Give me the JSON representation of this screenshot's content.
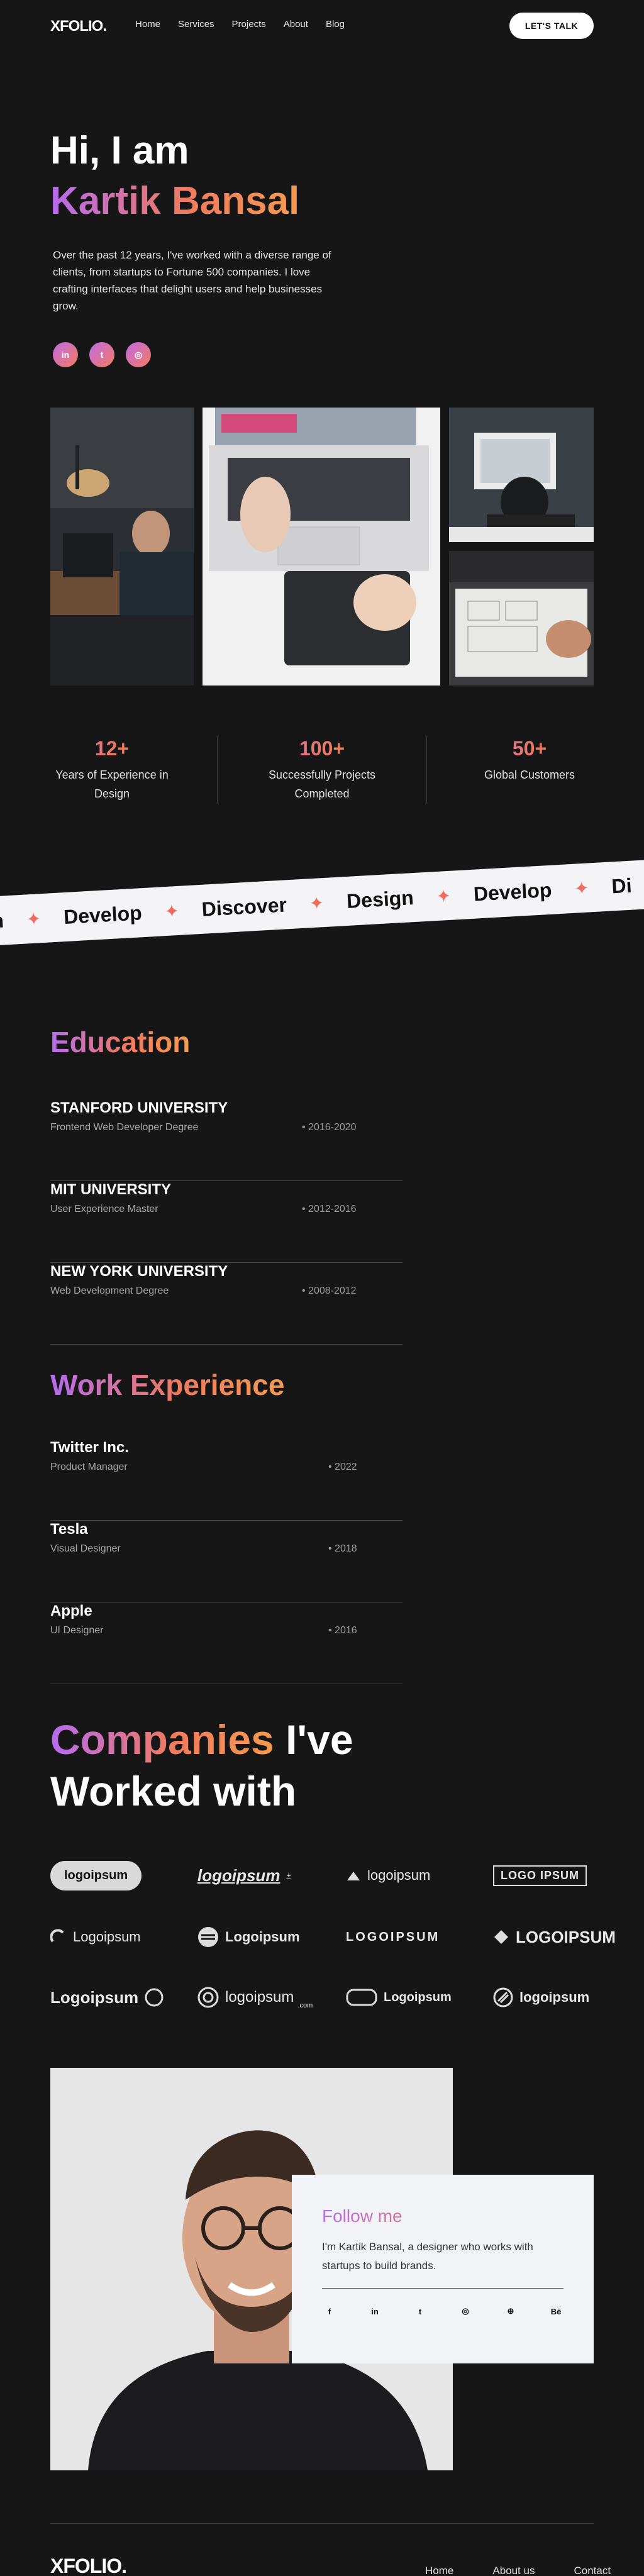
{
  "header": {
    "logo": "XFOLIO.",
    "nav": [
      "Home",
      "Services",
      "Projects",
      "About",
      "Blog"
    ],
    "cta": "LET'S TALK"
  },
  "hero": {
    "greeting": "Hi, I am",
    "name": "Kartik Bansal",
    "intro": "Over the past 12 years, I've worked with a diverse range of clients, from startups to Fortune 500 companies. I love crafting interfaces that delight users and help businesses grow.",
    "socials": [
      {
        "icon": "linkedin-icon",
        "glyph": "in"
      },
      {
        "icon": "twitter-icon",
        "glyph": "t"
      },
      {
        "icon": "instagram-icon",
        "glyph": "◎"
      }
    ]
  },
  "stats": [
    {
      "value": "12+",
      "label_1": "Years of Experience in",
      "label_2": "Design"
    },
    {
      "value": "100+",
      "label_1": "Successfully Projects",
      "label_2": "Completed"
    },
    {
      "value": "50+",
      "label_1": "Global Customers",
      "label_2": ""
    }
  ],
  "ribbon": {
    "words": [
      "gn",
      "Develop",
      "Discover",
      "Design",
      "Develop",
      "Di"
    ]
  },
  "education": {
    "title": "Education",
    "items": [
      {
        "name": "STANFORD UNIVERSITY",
        "role": "Frontend Web Developer Degree",
        "year": "• 2016-2020"
      },
      {
        "name": "MIT UNIVERSITY",
        "role": "User Experience Master",
        "year": "• 2012-2016"
      },
      {
        "name": "NEW YORK UNIVERSITY",
        "role": "Web Development Degree",
        "year": "• 2008-2012"
      }
    ]
  },
  "work": {
    "title": "Work Experience",
    "items": [
      {
        "name": "Twitter Inc.",
        "role": "Product Manager",
        "year": "• 2022"
      },
      {
        "name": "Tesla",
        "role": "Visual Designer",
        "year": "• 2018"
      },
      {
        "name": "Apple",
        "role": "UI Designer",
        "year": "• 2016"
      }
    ]
  },
  "companies": {
    "title_accent": "Companies",
    "title_rest_1": " I've",
    "title_rest_2": "Worked with",
    "logos": [
      "logoipsum",
      "logoipsum",
      "logoipsum",
      "LOGO IPSUM",
      "Logoipsum",
      "Logoipsum",
      "LOGOIPSUM",
      "LOGOIPSUM",
      "Logoipsum",
      "logoipsum",
      "Logoipsum",
      "logoipsum"
    ],
    "logo_sub": ".com"
  },
  "follow": {
    "title": "Follow me",
    "text": "I'm Kartik Bansal, a designer who works with startups to build brands.",
    "icons": [
      "facebook-icon",
      "linkedin-icon",
      "twitter-icon",
      "instagram-icon",
      "dribbble-icon",
      "behance-icon"
    ],
    "glyphs": [
      "f",
      "in",
      "t",
      "◎",
      "⊕",
      "Bē"
    ]
  },
  "footer": {
    "logo": "XFOLIO.",
    "nav": [
      "Home",
      "About us",
      "Contact"
    ]
  }
}
